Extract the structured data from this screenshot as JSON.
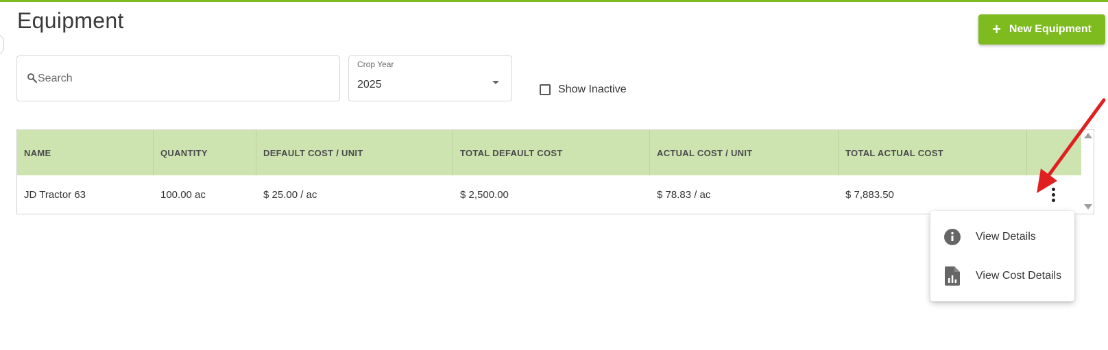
{
  "page": {
    "title": "Equipment"
  },
  "actions": {
    "new_equipment_label": "New Equipment"
  },
  "filters": {
    "search_placeholder": "Search",
    "crop_year_label": "Crop Year",
    "crop_year_value": "2025",
    "show_inactive_label": "Show Inactive",
    "show_inactive_checked": false
  },
  "table": {
    "columns": [
      "NAME",
      "QUANTITY",
      "DEFAULT COST / UNIT",
      "TOTAL DEFAULT COST",
      "ACTUAL COST / UNIT",
      "TOTAL ACTUAL COST"
    ],
    "rows": [
      {
        "name": "JD Tractor 63",
        "quantity": "100.00 ac",
        "default_cost_unit": "$ 25.00 / ac",
        "total_default_cost": "$ 2,500.00",
        "actual_cost_unit": "$ 78.83 / ac",
        "total_actual_cost": "$ 7,883.50"
      }
    ]
  },
  "row_menu": {
    "items": [
      {
        "label": "View Details",
        "icon": "info-icon"
      },
      {
        "label": "View Cost Details",
        "icon": "chart-document-icon"
      }
    ]
  },
  "colors": {
    "brand_green": "#7dbb1f",
    "header_green": "#cde4b0",
    "annotation_red": "#e02020"
  }
}
